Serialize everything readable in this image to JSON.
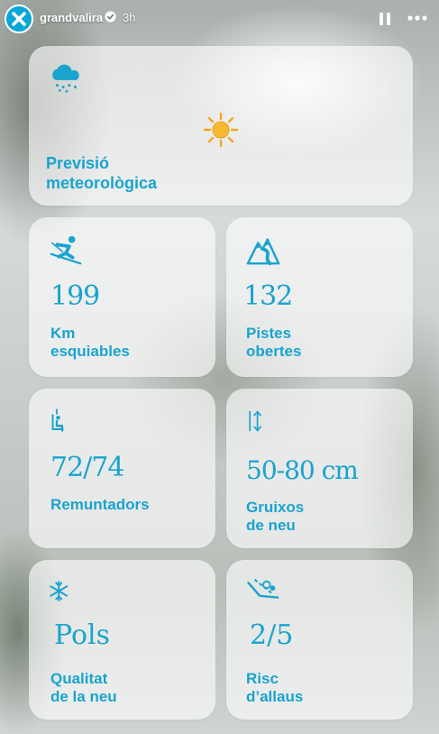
{
  "header": {
    "username": "grandvalira",
    "time_ago": "3h",
    "icons": {
      "avatar": "x-logo-icon",
      "verified": "verified-badge-icon",
      "pause": "pause-icon",
      "more": "more-dots-icon"
    }
  },
  "cards": {
    "weather": {
      "icon": "snow-cloud-icon",
      "sun_icon": "sun-icon",
      "label": "Previsió\nmeteorològica"
    },
    "km": {
      "icon": "skier-icon",
      "value": "199",
      "label": "Km\nesquiables"
    },
    "slopes": {
      "icon": "mountain-trail-icon",
      "value": "132",
      "label": "Pistes\nobertes"
    },
    "lifts": {
      "icon": "chairlift-icon",
      "value": "72/74",
      "label": "Remuntadors"
    },
    "snow_depth": {
      "icon": "depth-arrows-icon",
      "value": "50-80 cm",
      "label": "Gruixos\nde neu"
    },
    "quality": {
      "icon": "snowflake-icon",
      "value": "Pols",
      "label": "Qualitat\nde la neu"
    },
    "avalanche": {
      "icon": "avalanche-icon",
      "value": "2/5",
      "label": "Risc\nd’allaus"
    }
  },
  "colors": {
    "accent": "#1aa3cf",
    "sun": "#f5a623",
    "brand": "#0aa6d8"
  }
}
